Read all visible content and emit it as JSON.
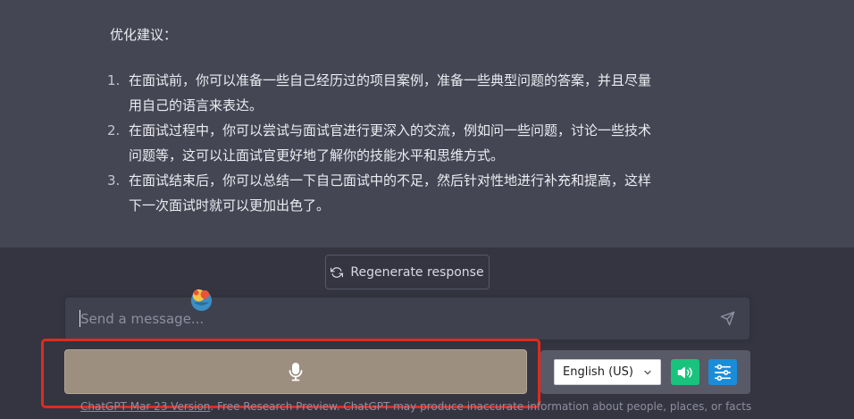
{
  "answer": {
    "title": "优化建议：",
    "items": [
      {
        "num": "1.",
        "line1": "在面试前，你可以准备一些自己经历过的项目案例，准备一些典型问题的答案，并且尽量",
        "line2": "用自己的语言来表达。"
      },
      {
        "num": "2.",
        "line1": "在面试过程中，你可以尝试与面试官进行更深入的交流，例如问一些问题，讨论一些技术",
        "line2": "问题等，这可以让面试官更好地了解你的技能水平和思维方式。"
      },
      {
        "num": "3.",
        "line1": "在面试结束后，你可以总结一下自己面试中的不足，然后针对性地进行补充和提高，这样",
        "line2": "下一次面试时就可以更加出色了。"
      }
    ]
  },
  "regenerate": {
    "label": "Regenerate response",
    "icon": "refresh-icon"
  },
  "composer": {
    "placeholder": "Send a message...",
    "send_icon": "send-icon"
  },
  "voice": {
    "mic_icon": "microphone-icon",
    "language": "English (US)",
    "speaker_icon": "speaker-icon",
    "settings_icon": "settings-sliders-icon",
    "accent_speaker": "#19c37d",
    "accent_settings": "#1a8cd8"
  },
  "footer": {
    "version_link": "ChatGPT Mar 23 Version",
    "text": ". Free Research Preview. ChatGPT may produce inaccurate information about people, places, or facts"
  },
  "colors": {
    "highlight": "#e02b1c",
    "mic_button": "#9c8f80"
  }
}
